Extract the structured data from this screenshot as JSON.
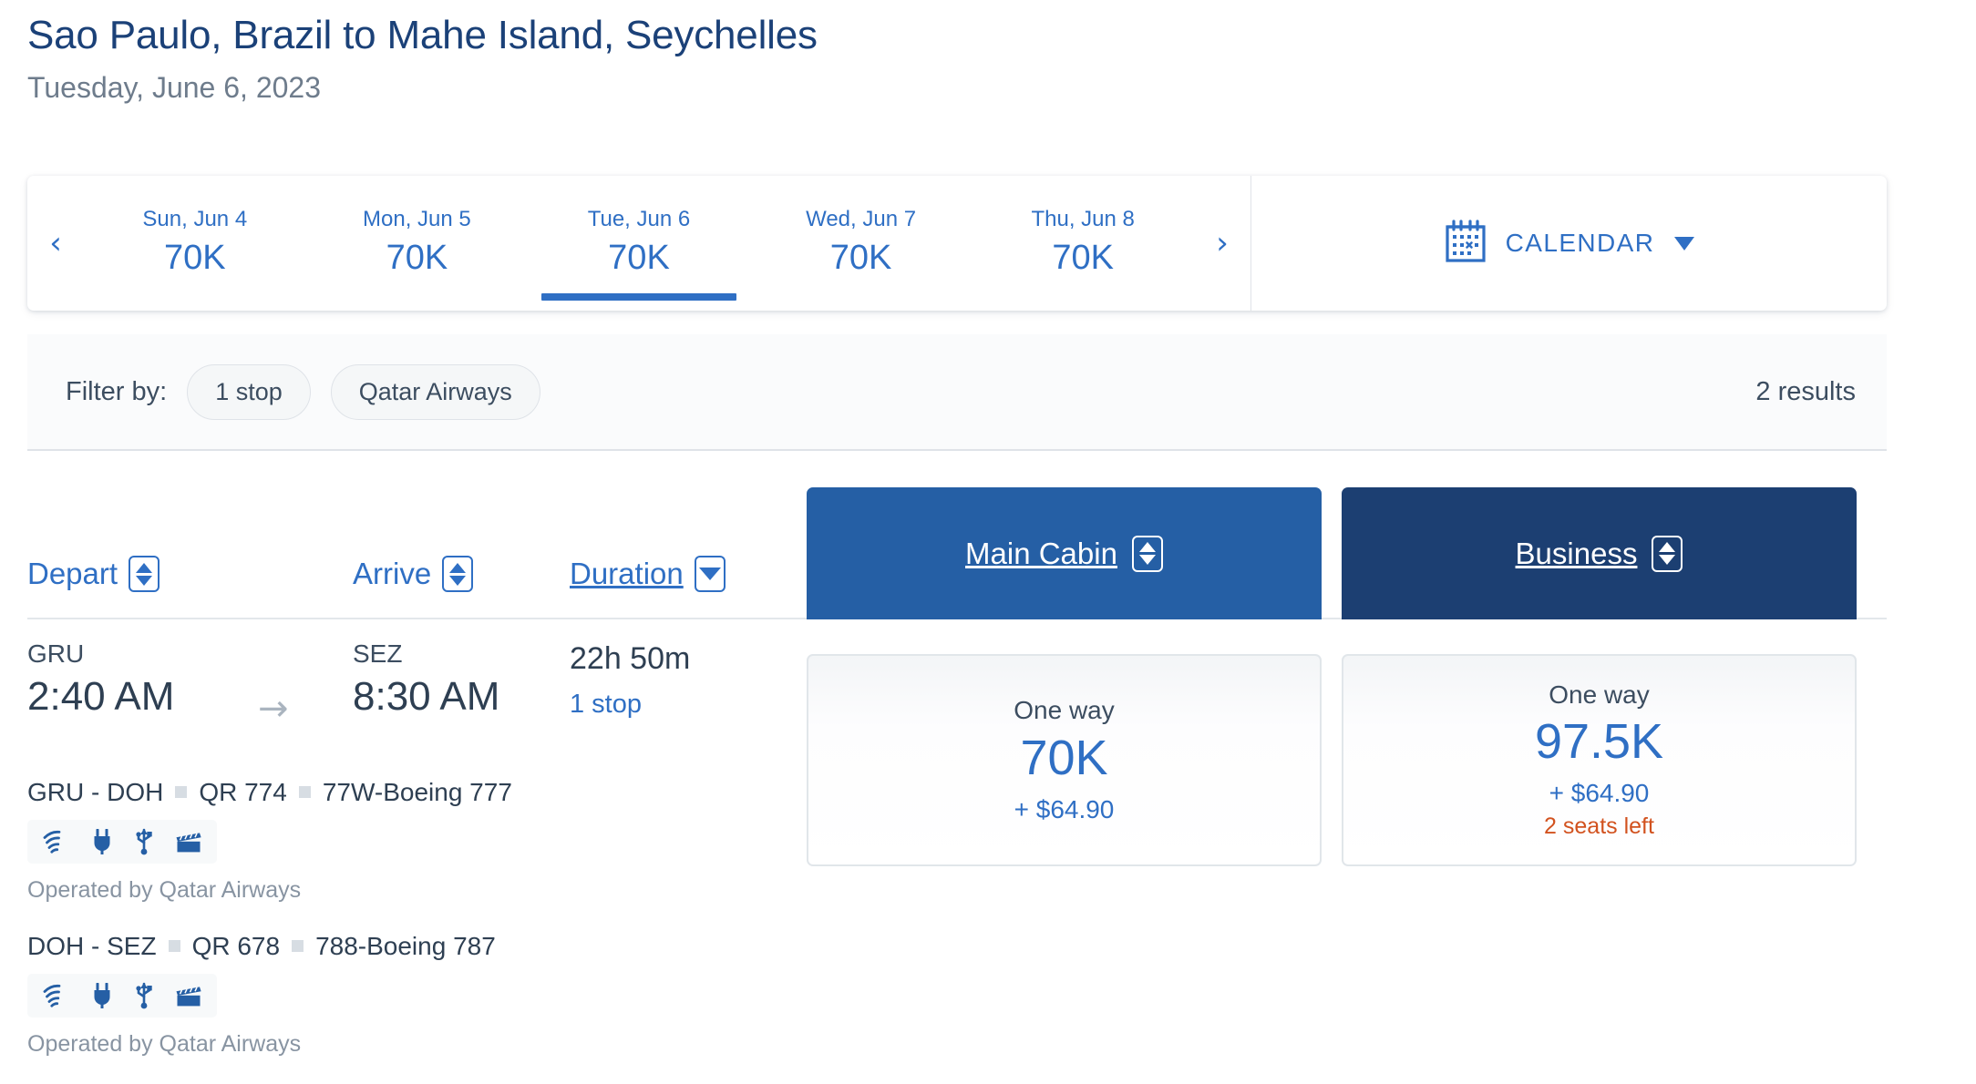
{
  "header": {
    "route_title": "Sao Paulo, Brazil to Mahe Island, Seychelles",
    "route_date": "Tuesday, June 6, 2023"
  },
  "date_strip": {
    "prev_arrow": "‹",
    "next_arrow": "›",
    "dates": [
      {
        "label": "Sun, Jun 4",
        "price": "70K",
        "selected": false
      },
      {
        "label": "Mon, Jun 5",
        "price": "70K",
        "selected": false
      },
      {
        "label": "Tue, Jun 6",
        "price": "70K",
        "selected": true
      },
      {
        "label": "Wed, Jun 7",
        "price": "70K",
        "selected": false
      },
      {
        "label": "Thu, Jun 8",
        "price": "70K",
        "selected": false
      }
    ],
    "calendar_label": "CALENDAR",
    "calendar_icon": "calendar-icon",
    "caret_icon": "chevron-down-icon"
  },
  "filter_bar": {
    "label": "Filter by:",
    "chips": [
      "1 stop",
      "Qatar Airways"
    ],
    "results": "2 results"
  },
  "sort_header": {
    "depart": {
      "label": "Depart",
      "active": false,
      "icon": "sort-updown-icon"
    },
    "arrive": {
      "label": "Arrive",
      "active": false,
      "icon": "sort-updown-icon"
    },
    "duration": {
      "label": "Duration",
      "active": true,
      "icon": "sort-down-icon"
    },
    "cabins": [
      {
        "label": "Main Cabin",
        "color": "#255fa5",
        "icon": "sort-updown-icon"
      },
      {
        "label": "Business",
        "color": "#1c3f72",
        "icon": "sort-updown-icon"
      }
    ]
  },
  "flight": {
    "depart": {
      "code": "GRU",
      "time": "2:40 AM"
    },
    "arrive": {
      "code": "SEZ",
      "time": "8:30 AM"
    },
    "arrow_icon": "arrow-right-icon",
    "duration": "22h 50m",
    "stops": "1 stop",
    "segments": [
      {
        "route": "GRU - DOH",
        "flight_number": "QR 774",
        "aircraft": "77W-Boeing 777",
        "amenities": [
          "wifi-icon",
          "power-plug-icon",
          "usb-icon",
          "entertainment-icon"
        ],
        "operated_by": "Operated by Qatar Airways"
      },
      {
        "route": "DOH - SEZ",
        "flight_number": "QR 678",
        "aircraft": "788-Boeing 787",
        "amenities": [
          "wifi-icon",
          "power-plug-icon",
          "usb-icon",
          "entertainment-icon"
        ],
        "operated_by": "Operated by Qatar Airways"
      }
    ],
    "fares": [
      {
        "cabin": "Main Cabin",
        "trip_type": "One way",
        "miles": "70K",
        "cash": "+ $64.90",
        "seats_left": ""
      },
      {
        "cabin": "Business",
        "trip_type": "One way",
        "miles": "97.5K",
        "cash": "+ $64.90",
        "seats_left": "2 seats left"
      }
    ]
  },
  "colors": {
    "title_blue": "#1b4178",
    "link_blue": "#2f6fc4",
    "main_cabin_blue": "#255fa5",
    "business_navy": "#1c3f72",
    "alert_orange": "#d2521f",
    "text_dark": "#2e3f52",
    "muted_gray": "#8894a2"
  }
}
